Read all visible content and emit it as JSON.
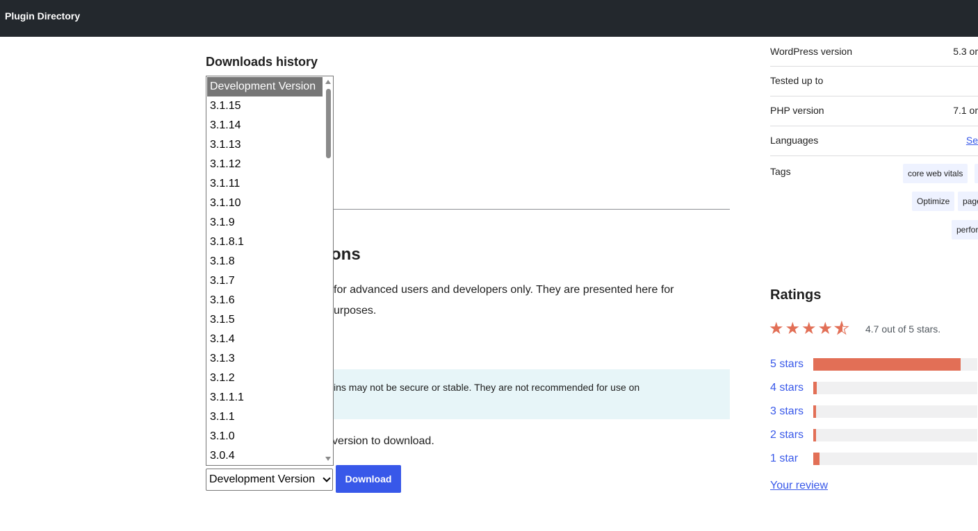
{
  "topbar": {
    "title": "Plugin Directory"
  },
  "downloads": {
    "section_title": "Downloads history",
    "heading_visible": "ons",
    "text_line1": "for advanced users and developers only. They are presented here for",
    "text_line2": "urposes.",
    "notice_text": "ins may not be secure or stable. They are not recommended for use on",
    "choose_text": "version to download.",
    "versions": [
      "Development Version",
      "3.1.15",
      "3.1.14",
      "3.1.13",
      "3.1.12",
      "3.1.11",
      "3.1.10",
      "3.1.9",
      "3.1.8.1",
      "3.1.8",
      "3.1.7",
      "3.1.6",
      "3.1.5",
      "3.1.4",
      "3.1.3",
      "3.1.2",
      "3.1.1.1",
      "3.1.1",
      "3.1.0",
      "3.0.4"
    ],
    "selected_version": "Development Version",
    "download_label": "Download"
  },
  "meta": {
    "wp_version_label": "WordPress version",
    "wp_version_value": "5.3 or",
    "tested_label": "Tested up to",
    "tested_value": "",
    "php_label": "PHP version",
    "php_value": "7.1 or",
    "languages_label": "Languages",
    "languages_value": "Se",
    "tags_label": "Tags",
    "tags": [
      "core web vitals",
      "Optimize",
      "page",
      "perfor"
    ]
  },
  "ratings": {
    "title": "Ratings",
    "summary": "4.7 out of 5 stars.",
    "average": 4.7,
    "rows": [
      {
        "label": "5 stars",
        "fraction": 0.9
      },
      {
        "label": "4 stars",
        "fraction": 0.02
      },
      {
        "label": "3 stars",
        "fraction": 0.01
      },
      {
        "label": "2 stars",
        "fraction": 0.01
      },
      {
        "label": "1 star",
        "fraction": 0.04
      }
    ],
    "your_review": "Your review"
  },
  "colors": {
    "accent": "#3858e9",
    "star": "#e26f56",
    "topbar": "#23282d",
    "notice": "#e7f5f8"
  },
  "icons": {
    "star": "star-icon",
    "half_star": "star-half-icon",
    "caret": "chevron-down-icon"
  }
}
